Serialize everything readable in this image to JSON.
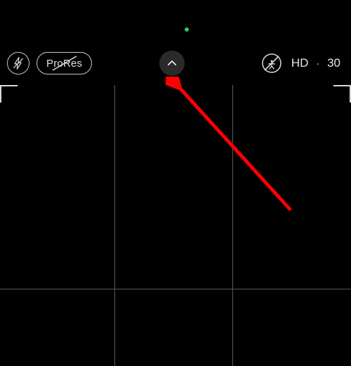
{
  "toolbar": {
    "flash": {
      "name": "flash-off-icon"
    },
    "prores": {
      "label": "ProRes",
      "name": "prores-toggle"
    },
    "expand": {
      "name": "expand-controls-button"
    },
    "actionmode": {
      "name": "action-mode-toggle"
    },
    "resolution_label": "HD",
    "separator": "·",
    "fps_label": "30"
  },
  "annotations": {
    "arrow_color": "#ff0000"
  },
  "colors": {
    "privacy_dot": "#34c759",
    "grid_line": "#5a5a5a",
    "icon_stroke": "#d9d9d9"
  }
}
